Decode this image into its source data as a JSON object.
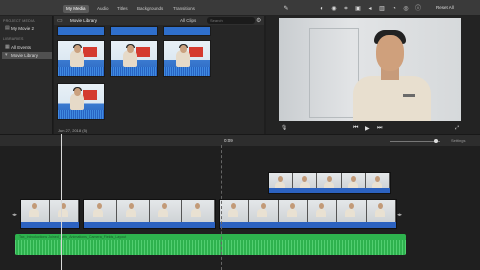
{
  "toolbar": {
    "tabs": [
      {
        "label": "My Media"
      },
      {
        "label": "Audio"
      },
      {
        "label": "Titles"
      },
      {
        "label": "Backgrounds"
      },
      {
        "label": "Transitions"
      }
    ],
    "icons": [
      "magic-wand",
      "color-balance",
      "color-correction",
      "crop",
      "stabilization",
      "volume",
      "noise-reduction",
      "speed",
      "filter",
      "info"
    ],
    "reset_all": "Reset All"
  },
  "sidebar": {
    "section_project": "PROJECT MEDIA",
    "project_item": "My Movie 2",
    "section_libraries": "LIBRARIES",
    "items": [
      {
        "label": "All Events"
      },
      {
        "label": "Movie Library"
      }
    ]
  },
  "browser": {
    "title": "Movie Library",
    "filter": "All Clips",
    "search_placeholder": "Search",
    "date_label": "Jun 27, 2018  (5)"
  },
  "timeline": {
    "timecode": "0:09",
    "settings_label": "Settings",
    "audio_label": "Tax_Introductions Joined_with_Animations_Camera_Fields_Layout"
  },
  "colors": {
    "accent_blue": "#2f6fcc",
    "audio_green": "#2eb24e",
    "selection": "#505050"
  }
}
